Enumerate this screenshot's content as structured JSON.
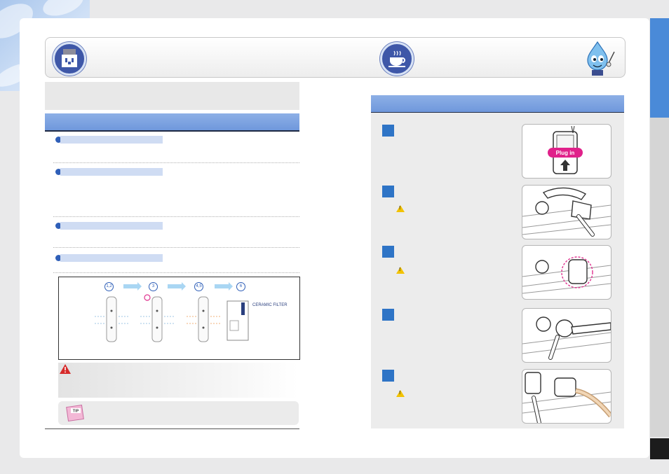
{
  "page_decor": {
    "tab_color": "#4a8ad8",
    "section_bar_color": "#78a0df"
  },
  "header": {
    "left_icon": "filter-unit-icon",
    "middle_icon": "coffee-cup-icon",
    "mascot": "water-drop-mascot"
  },
  "diagram": {
    "step_numbers": [
      "1,2",
      "3",
      "4,5",
      "6"
    ],
    "ceramic_label": "CERAMIC FILTER"
  },
  "warning": {
    "icon": "warning-triangle-icon",
    "color": "#d62a2a"
  },
  "tip": {
    "label": "TIP"
  },
  "steps_right": {
    "photo1_text": "Plug in"
  }
}
